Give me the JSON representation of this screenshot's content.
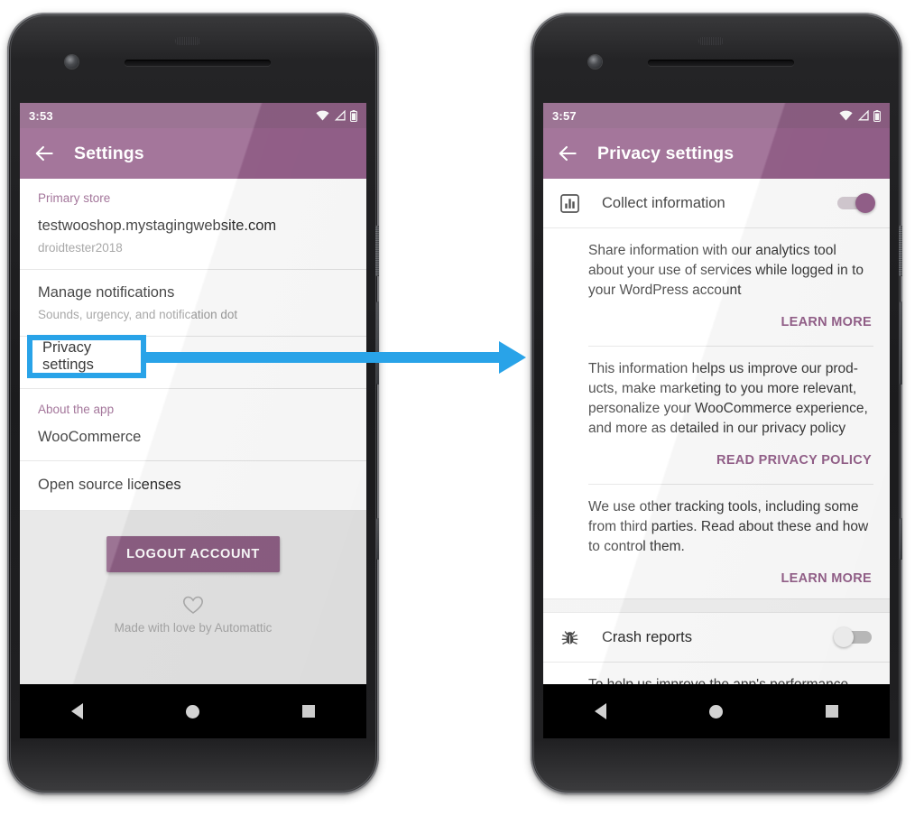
{
  "annotation": {
    "highlight_label": "Privacy settings",
    "arrow_color": "#29a3e8",
    "highlight_border_color": "#29a3e8"
  },
  "theme": {
    "primary": "#96628c",
    "status_bar": "#8d5f84",
    "accent_text": "#96628c",
    "footer_bg": "#e6e6e6"
  },
  "phone_left": {
    "status": {
      "time": "3:53",
      "icons": [
        "wifi-icon",
        "signal-icon",
        "battery-icon"
      ]
    },
    "appbar": {
      "back_icon": "back-arrow-icon",
      "title": "Settings"
    },
    "sections": [
      {
        "header": "Primary store",
        "title": "testwooshop.mystagingwebsite.com",
        "subtitle": "droidtester2018"
      },
      {
        "header": "",
        "title": "Manage notifications",
        "subtitle": "Sounds, urgency, and notification dot"
      },
      {
        "header": "",
        "title": "Privacy settings",
        "subtitle": ""
      },
      {
        "header": "About the app",
        "title": "WooCommerce",
        "subtitle": ""
      },
      {
        "header": "",
        "title": "Open source licenses",
        "subtitle": ""
      }
    ],
    "footer": {
      "logout_label": "LOGOUT ACCOUNT",
      "heart_icon": "heart-icon",
      "made_with_love": "Made with love by Automattic"
    },
    "navbar": {
      "back": "nav-back-icon",
      "home": "nav-home-icon",
      "recents": "nav-recents-icon"
    }
  },
  "phone_right": {
    "status": {
      "time": "3:57",
      "icons": [
        "wifi-icon",
        "signal-icon",
        "battery-icon"
      ]
    },
    "appbar": {
      "back_icon": "back-arrow-icon",
      "title": "Privacy settings"
    },
    "items": [
      {
        "icon": "analytics-bar-chart-icon",
        "label": "Collect information",
        "toggle_state": "on",
        "blocks": [
          {
            "text": "Share information with our analytics tool about your use of services while logged in to your WordPress account",
            "link": "LEARN MORE"
          },
          {
            "text": "This information helps us improve our prod-ucts, make marketing to you more relevant, personalize your WooCommerce experience, and more as detailed in our privacy policy",
            "link": "READ PRIVACY POLICY"
          },
          {
            "text": "We use other tracking tools, including some from third parties. Read about these and how to control them.",
            "link": "LEARN MORE"
          }
        ]
      },
      {
        "icon": "bug-icon",
        "label": "Crash reports",
        "toggle_state": "off",
        "blocks": [
          {
            "text": "To help us improve the app's performance and fix the occasional bug, enable automatic",
            "link": ""
          }
        ]
      }
    ],
    "navbar": {
      "back": "nav-back-icon",
      "home": "nav-home-icon",
      "recents": "nav-recents-icon"
    }
  }
}
